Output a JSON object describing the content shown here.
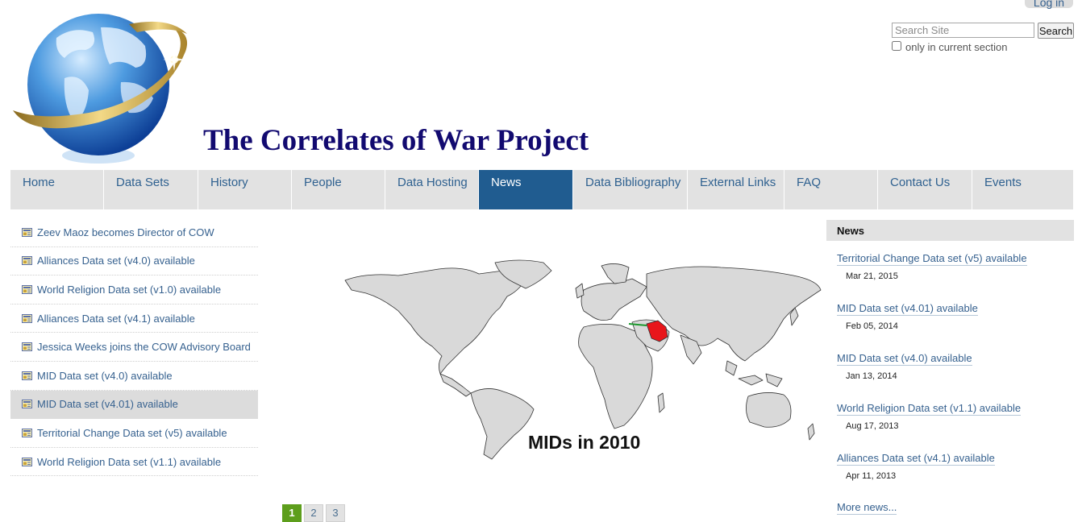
{
  "header": {
    "login_label": "Log in",
    "site_title": "The Correlates of War Project",
    "logo_icon": "globe-logo-icon"
  },
  "search": {
    "placeholder": "Search Site",
    "button_label": "Search",
    "section_only_label": "only in current section",
    "section_only_checked": false
  },
  "nav": {
    "items": [
      {
        "label": "Home"
      },
      {
        "label": "Data Sets"
      },
      {
        "label": "History"
      },
      {
        "label": "People"
      },
      {
        "label": "Data Hosting"
      },
      {
        "label": "News"
      },
      {
        "label": "Data Bibliography"
      },
      {
        "label": "External Links"
      },
      {
        "label": "FAQ"
      },
      {
        "label": "Contact Us"
      },
      {
        "label": "Events"
      }
    ],
    "active": "News"
  },
  "news_list": {
    "icon": "news-item-icon",
    "items": [
      {
        "label": "Zeev Maoz becomes Director of COW"
      },
      {
        "label": "Alliances Data set (v4.0) available"
      },
      {
        "label": "World Religion Data set (v1.0) available"
      },
      {
        "label": "Alliances Data set (v4.1) available"
      },
      {
        "label": "Jessica Weeks joins the COW Advisory Board"
      },
      {
        "label": "MID Data set (v4.0) available"
      },
      {
        "label": "MID Data set (v4.01) available"
      },
      {
        "label": "Territorial Change Data set (v5) available"
      },
      {
        "label": "World Religion Data set (v1.1) available"
      }
    ],
    "selected": "MID Data set (v4.01) available"
  },
  "feature": {
    "map_caption": "MIDs in 2010",
    "map_icon": "world-map-icon"
  },
  "pagination": {
    "pages": [
      "1",
      "2",
      "3"
    ],
    "current": "1"
  },
  "news_portlet": {
    "heading": "News",
    "items": [
      {
        "title": "Territorial Change Data set (v5) available",
        "date": "Mar 21, 2015"
      },
      {
        "title": "MID Data set (v4.01) available",
        "date": "Feb 05, 2014"
      },
      {
        "title": "MID Data set (v4.0) available",
        "date": "Jan 13, 2014"
      },
      {
        "title": "World Religion Data set (v1.1) available",
        "date": "Aug 17, 2013"
      },
      {
        "title": "Alliances Data set (v4.1) available",
        "date": "Apr 11, 2013"
      }
    ],
    "more_label": "More news..."
  },
  "colors": {
    "brand_navy": "#120a70",
    "nav_active": "#205c90",
    "link": "#36618f",
    "pager_current": "#5d9e1c",
    "map_highlight": "#e8161b"
  }
}
